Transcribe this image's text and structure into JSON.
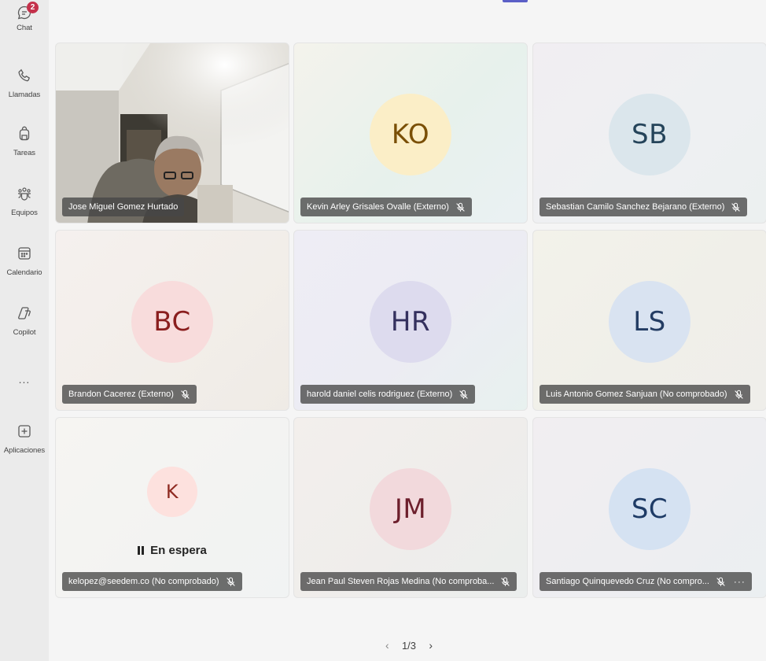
{
  "sidebar": {
    "chat": {
      "label": "Chat",
      "badge": "2"
    },
    "calls": {
      "label": "Llamadas"
    },
    "tasks": {
      "label": "Tareas"
    },
    "teams": {
      "label": "Equipos"
    },
    "calendar": {
      "label": "Calendario"
    },
    "copilot": {
      "label": "Copilot"
    },
    "more": {
      "label": "..."
    },
    "apps": {
      "label": "Aplicaciones"
    }
  },
  "participants": [
    {
      "name": "Jose Miguel Gomez Hurtado",
      "initials": "",
      "video": true,
      "muted": false
    },
    {
      "name": "Kevin Arley Grisales Ovalle (Externo)",
      "initials": "KO",
      "avatar_bg": "#fbeec7",
      "avatar_fg": "#7a4f06",
      "muted": true
    },
    {
      "name": "Sebastian Camilo Sanchez Bejarano (Externo)",
      "initials": "SB",
      "avatar_bg": "#dbe6ec",
      "avatar_fg": "#25445a",
      "muted": true
    },
    {
      "name": "Brandon Cacerez (Externo)",
      "initials": "BC",
      "avatar_bg": "#f8dcdc",
      "avatar_fg": "#8a1e1e",
      "muted": true
    },
    {
      "name": "harold daniel celis rodriguez (Externo)",
      "initials": "HR",
      "avatar_bg": "#dddbee",
      "avatar_fg": "#34305e",
      "muted": true
    },
    {
      "name": "Luis Antonio Gomez Sanjuan (No comprobado)",
      "initials": "LS",
      "avatar_bg": "#d9e3f1",
      "avatar_fg": "#233c63",
      "muted": true
    },
    {
      "name": "kelopez@seedem.co (No comprobado)",
      "initials": "K",
      "avatar_bg": "#fde1de",
      "avatar_fg": "#8f2a21",
      "muted": true,
      "status": "En espera"
    },
    {
      "name": "Jean Paul Steven Rojas Medina (No comproba...",
      "initials": "JM",
      "avatar_bg": "#f2d9dc",
      "avatar_fg": "#6d1f2c",
      "muted": true
    },
    {
      "name": "Santiago Quinquevedo Cruz (No compro...",
      "initials": "SC",
      "avatar_bg": "#d5e2f2",
      "avatar_fg": "#1e3b66",
      "muted": true,
      "more": "···"
    }
  ],
  "pagination": {
    "current": "1/3"
  },
  "colors": {
    "accent": "#5b5fc7",
    "badge": "#c4314b"
  }
}
